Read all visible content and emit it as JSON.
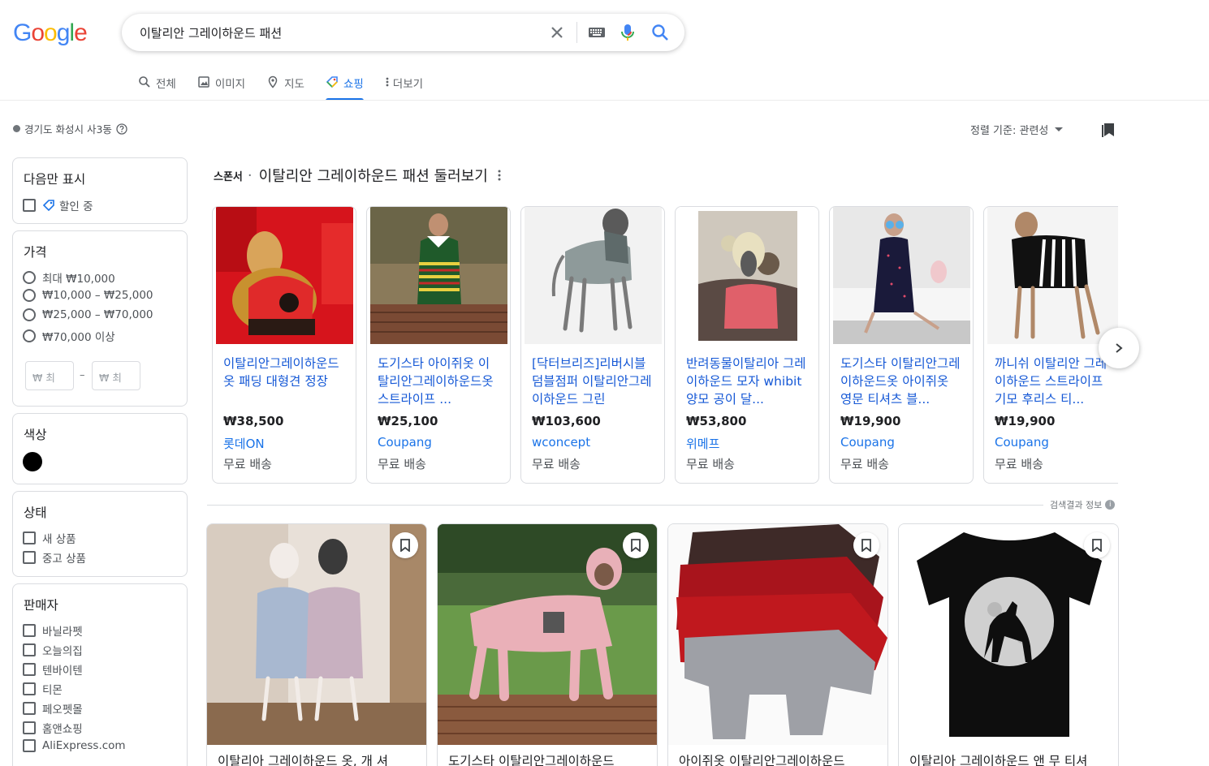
{
  "logo": {
    "letters": [
      "G",
      "o",
      "o",
      "g",
      "l",
      "e"
    ],
    "colors": [
      "#4285f4",
      "#ea4335",
      "#fbbc05",
      "#4285f4",
      "#34a853",
      "#ea4335"
    ]
  },
  "search": {
    "query": "이탈리안 그레이하운드 패션"
  },
  "tabs": [
    {
      "label": "전체",
      "icon": "search-icon"
    },
    {
      "label": "이미지",
      "icon": "image-icon"
    },
    {
      "label": "지도",
      "icon": "map-pin-icon"
    },
    {
      "label": "쇼핑",
      "icon": "tag-icon",
      "active": true
    },
    {
      "label": "더보기",
      "icon": "more-vert-icon"
    }
  ],
  "location": "경기도 화성시 사3동",
  "sort": {
    "label": "정렬 기준: 관련성"
  },
  "filters": {
    "show_only": {
      "title": "다음만 표시",
      "option": "할인 중"
    },
    "price": {
      "title": "가격",
      "options": [
        "최대 ₩10,000",
        "₩10,000 – ₩25,000",
        "₩25,000 – ₩70,000",
        "₩70,000 이상"
      ],
      "min_placeholder": "₩ 최",
      "max_placeholder": "₩ 최"
    },
    "color": {
      "title": "색상",
      "swatch": "#000000"
    },
    "condition": {
      "title": "상태",
      "options": [
        "새 상품",
        "중고 상품"
      ]
    },
    "seller": {
      "title": "판매자",
      "options": [
        "바닐라펫",
        "오늘의집",
        "텐바이텐",
        "티몬",
        "페오펫몰",
        "홈앤쇼핑",
        "AliExpress.com"
      ]
    }
  },
  "sponsored": {
    "label": "스폰서",
    "title": "이탈리안 그레이하운드 패션 둘러보기",
    "items": [
      {
        "title": "이탈리안그레이하운드 옷 패딩 대형견 정장",
        "price": "₩38,500",
        "store": "롯데ON",
        "shipping": "무료 배송"
      },
      {
        "title": "도기스타 아이쥐옷 이탈리안그레이하운드옷 스트라이프 ...",
        "price": "₩25,100",
        "store": "Coupang",
        "shipping": "무료 배송"
      },
      {
        "title": "[닥터브리즈]리버시블 덤블점퍼 이탈리안그레이하운드 그린",
        "price": "₩103,600",
        "store": "wconcept",
        "shipping": "무료 배송"
      },
      {
        "title": "반려동물이탈리아 그레이하운드 모자 whibit 양모 공이 달...",
        "price": "₩53,800",
        "store": "위메프",
        "shipping": "무료 배송"
      },
      {
        "title": "도기스타 이탈리안그레이하운드옷 아이쥐옷 영문 티셔츠 블...",
        "price": "₩19,900",
        "store": "Coupang",
        "shipping": "무료 배송"
      },
      {
        "title": "까니쉬 이탈리안 그레이하운드 스트라이프 기모 후리스 티...",
        "price": "₩19,900",
        "store": "Coupang",
        "shipping": "무료 배송"
      }
    ]
  },
  "about_results": "검색결과 정보",
  "grid": [
    {
      "title": "이탈리아 그레이하운드 옷, 개 셔"
    },
    {
      "title": "도기스타 이탈리안그레이하운드"
    },
    {
      "title": "아이쥐옷 이탈리안그레이하운드"
    },
    {
      "title": "이탈리아 그레이하운드 앤 무 티셔"
    }
  ]
}
